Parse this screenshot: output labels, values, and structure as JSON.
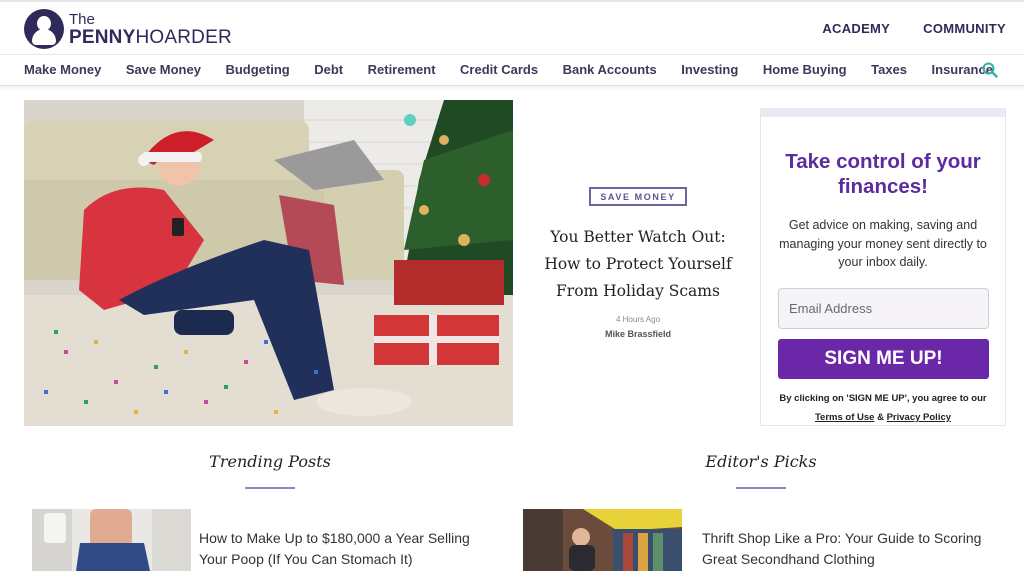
{
  "header": {
    "logo_the": "The",
    "logo_penny": "PENNY",
    "logo_hoarder": "HOARDER",
    "top_links": [
      "ACADEMY",
      "COMMUNITY"
    ]
  },
  "nav": {
    "items": [
      "Make Money",
      "Save Money",
      "Budgeting",
      "Debt",
      "Retirement",
      "Credit Cards",
      "Bank Accounts",
      "Investing",
      "Home Buying",
      "Taxes",
      "Insurance"
    ],
    "search_icon": "search-icon",
    "accent_color": "#2bb3a3"
  },
  "hero": {
    "category": "SAVE MONEY",
    "title": "You Better Watch Out: How to Protect Yourself From Holiday Scams",
    "time": "4 Hours Ago",
    "author": "Mike Brassfield"
  },
  "signup": {
    "title": "Take control of your finances!",
    "description": "Get advice on making, saving and managing your money sent directly to your inbox daily.",
    "email_placeholder": "Email Address",
    "button_label": "SIGN ME UP!",
    "legal_prefix": "By clicking on 'SIGN ME UP', you agree to our",
    "terms_label": "Terms of Use",
    "amp": "&",
    "privacy_label": "Privacy Policy",
    "title_color": "#5b2b9f",
    "button_color": "#6a27a8"
  },
  "trending": {
    "heading": "Trending Posts",
    "posts": [
      {
        "title": "How to Make Up to $180,000 a Year Selling Your Poop (If You Can Stomach It)"
      }
    ]
  },
  "editors": {
    "heading": "Editor's Picks",
    "posts": [
      {
        "title": "Thrift Shop Like a Pro: Your Guide to Scoring Great Secondhand Clothing"
      }
    ]
  }
}
